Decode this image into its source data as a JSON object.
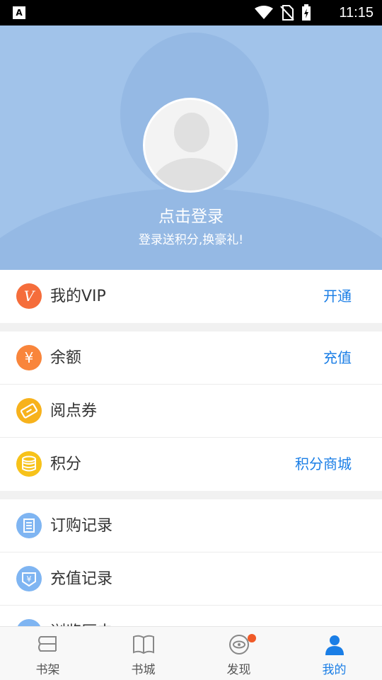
{
  "status_bar": {
    "time": "11:15"
  },
  "header": {
    "title": "点击登录",
    "subtitle": "登录送积分,换豪礼!"
  },
  "groups": [
    [
      {
        "label": "我的VIP",
        "action": "开通",
        "icon": "vip-icon",
        "color": "#f56d3b"
      }
    ],
    [
      {
        "label": "余额",
        "action": "充值",
        "icon": "yen-icon",
        "color": "#f9853b"
      },
      {
        "label": "阅点券",
        "action": "",
        "icon": "ticket-icon",
        "color": "#f7b21c"
      },
      {
        "label": "积分",
        "action": "积分商城",
        "icon": "coins-icon",
        "color": "#f7c21a"
      }
    ],
    [
      {
        "label": "订购记录",
        "action": "",
        "icon": "document-icon",
        "color": "#7fb5f2"
      },
      {
        "label": "充值记录",
        "action": "",
        "icon": "recharge-icon",
        "color": "#7fb5f2"
      },
      {
        "label": "浏览历史",
        "action": "",
        "icon": "eye-icon",
        "color": "#7fb5f2"
      }
    ]
  ],
  "tabs": [
    {
      "label": "书架",
      "icon": "bookshelf-icon",
      "active": false
    },
    {
      "label": "书城",
      "icon": "open-book-icon",
      "active": false
    },
    {
      "label": "发现",
      "icon": "discover-eye-icon",
      "active": false,
      "badge": true
    },
    {
      "label": "我的",
      "icon": "person-icon",
      "active": true
    }
  ],
  "colors": {
    "accent": "#1a7ee6",
    "header_bg": "#a1c3ea",
    "badge": "#f05a28"
  }
}
